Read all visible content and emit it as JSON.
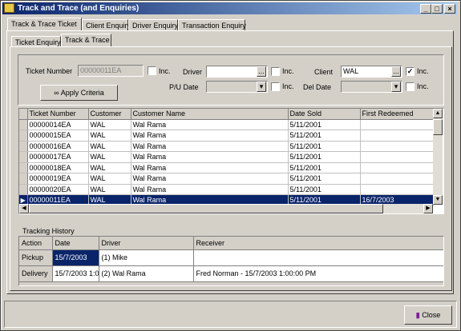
{
  "window": {
    "title": "Track and Trace (and Enquiries)",
    "minimize": "_",
    "maximize": "□",
    "close": "×"
  },
  "main_tabs": [
    "Track & Trace Ticket",
    "Client Enquiry",
    "Driver Enquiry",
    "Transaction Enquiry"
  ],
  "sub_tabs": [
    "Ticket Enquiry",
    "Track & Trace"
  ],
  "criteria": {
    "ticket_number_label": "Ticket Number",
    "ticket_number_value": "00000011EA",
    "inc_label": "Inc.",
    "driver_label": "Driver",
    "driver_value": "",
    "client_label": "Client",
    "client_value": "WAL",
    "client_inc_checked": "✓",
    "pu_date_label": "P/U Date",
    "del_date_label": "Del Date",
    "ellipsis": "...",
    "apply_label": "Apply Criteria"
  },
  "grid": {
    "columns": [
      "Ticket Number",
      "Customer",
      "Customer Name",
      "Date Sold",
      "First Redeemed"
    ],
    "rows": [
      [
        "00000014EA",
        "WAL",
        "Wal Rama",
        "5/11/2001",
        ""
      ],
      [
        "00000015EA",
        "WAL",
        "Wal Rama",
        "5/11/2001",
        ""
      ],
      [
        "00000016EA",
        "WAL",
        "Wal Rama",
        "5/11/2001",
        ""
      ],
      [
        "00000017EA",
        "WAL",
        "Wal Rama",
        "5/11/2001",
        ""
      ],
      [
        "00000018EA",
        "WAL",
        "Wal Rama",
        "5/11/2001",
        ""
      ],
      [
        "00000019EA",
        "WAL",
        "Wal Rama",
        "5/11/2001",
        ""
      ],
      [
        "00000020EA",
        "WAL",
        "Wal Rama",
        "5/11/2001",
        ""
      ],
      [
        "00000011EA",
        "WAL",
        "Wal Rama",
        "5/11/2001",
        "16/7/2003"
      ]
    ],
    "selected_index": 7
  },
  "tracking": {
    "title": "Tracking History",
    "columns": [
      "Action",
      "Date",
      "Driver",
      "Receiver"
    ],
    "rows": [
      [
        "Pickup",
        "15/7/2003",
        "(1) Mike",
        ""
      ],
      [
        "Delivery",
        "15/7/2003 1:0",
        "(2) Wal Rama",
        "Fred Norman - 15/7/2003 1:00:00 PM"
      ]
    ]
  },
  "footer": {
    "close_label": "Close"
  },
  "colors": {
    "face": "#d4d0c8",
    "selection": "#0a246a",
    "title_gradient_end": "#a6caf0"
  }
}
